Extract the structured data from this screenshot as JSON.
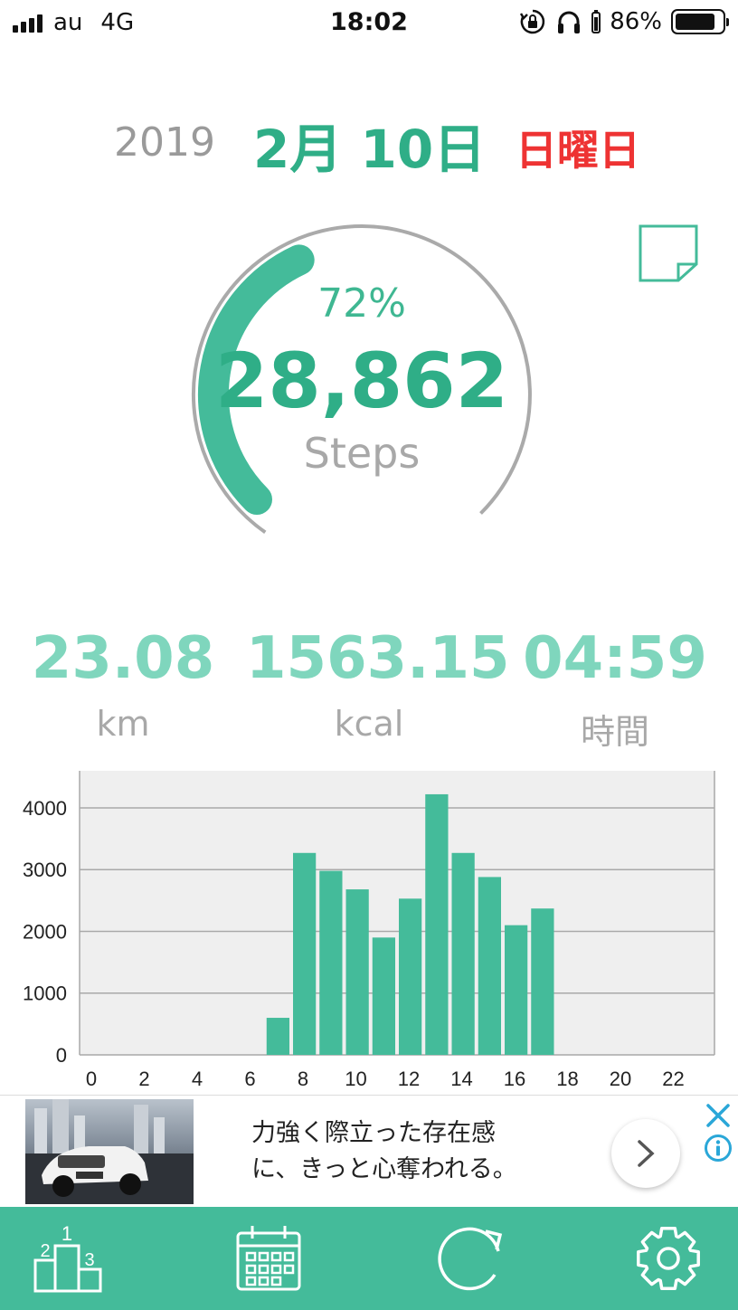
{
  "status_bar": {
    "carrier": "au",
    "network": "4G",
    "time": "18:02",
    "battery": "86%",
    "battery_level": 0.86,
    "icons": [
      "signal-icon",
      "rotation-lock-icon",
      "headphones-icon",
      "battery-icon"
    ]
  },
  "date": {
    "year": "2019",
    "month_day": "2月 10日",
    "weekday": "日曜日",
    "weekday_color": "#ee3333"
  },
  "goal": {
    "percent_label": "72%",
    "progress": 0.72,
    "steps": "28,862",
    "steps_label": "Steps"
  },
  "metrics": [
    {
      "value": "23.08",
      "unit": "km"
    },
    {
      "value": "1563.15",
      "unit": "kcal"
    },
    {
      "value": "04:59",
      "unit": "時間"
    }
  ],
  "chart_data": {
    "type": "bar",
    "x": [
      0,
      1,
      2,
      3,
      4,
      5,
      6,
      7,
      8,
      9,
      10,
      11,
      12,
      13,
      14,
      15,
      16,
      17,
      18,
      19,
      20,
      21,
      22,
      23
    ],
    "values": [
      0,
      0,
      0,
      0,
      0,
      0,
      0,
      600,
      3270,
      2980,
      2680,
      1900,
      2530,
      4220,
      3270,
      2880,
      2100,
      2370,
      0,
      0,
      0,
      0,
      0,
      0
    ],
    "x_ticks": [
      "0",
      "2",
      "4",
      "6",
      "8",
      "10",
      "12",
      "14",
      "16",
      "18",
      "20",
      "22"
    ],
    "y_ticks": [
      "0",
      "1000",
      "2000",
      "3000",
      "4000"
    ],
    "ylim": [
      0,
      4600
    ],
    "grid": true,
    "bar_color": "#44bb9a"
  },
  "ad": {
    "line1": "力強く際立った存在感",
    "line2": "に、きっと心奪われる。"
  },
  "tabbar": {
    "tabs": [
      "ranking-icon",
      "calendar-icon",
      "refresh-icon",
      "settings-icon"
    ],
    "accent": "#44bb9a"
  }
}
